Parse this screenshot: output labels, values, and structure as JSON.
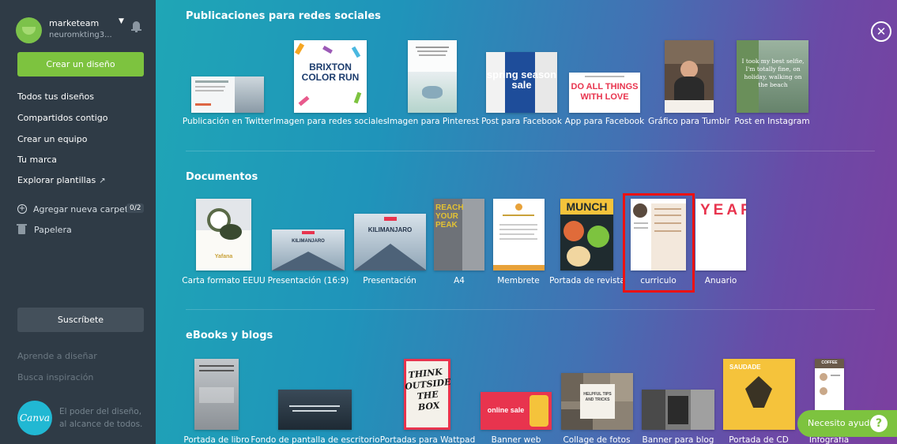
{
  "sidebar": {
    "team_name": "marketeam",
    "team_subtitle": "neuromkting3...",
    "create_label": "Crear un diseño",
    "nav": [
      "Todos tus diseños",
      "Compartidos contigo",
      "Crear un equipo",
      "Tu marca",
      "Explorar plantillas"
    ],
    "explore_arrow": "↗",
    "folder_label": "Agregar nueva carpeta",
    "folder_count": "0/2",
    "trash_label": "Papelera",
    "subscribe_label": "Suscríbete",
    "learn_label": "Aprende a diseñar",
    "inspire_label": "Busca inspiración",
    "logo_text": "Canva",
    "slogan_line1": "El poder del diseño,",
    "slogan_line2": "al alcance de todos."
  },
  "main": {
    "close_symbol": "✕",
    "social": {
      "title": "Publicaciones para redes sociales",
      "items": [
        "Publicación en Twitter",
        "Imagen para redes sociales",
        "Imagen para Pinterest",
        "Post para Facebook",
        "App para Facebook",
        "Gráfico para Tumblr",
        "Post en Instagram"
      ],
      "thumb_text": {
        "brixton": "BRIXTON COLOR RUN",
        "spring": "spring season sale",
        "doall": "DO ALL THINGS WITH LOVE",
        "insta": "I took my best selfie, I'm totally fine, on holiday, walking on the beach"
      }
    },
    "documents": {
      "title": "Documentos",
      "items": [
        "Carta formato EEUU",
        "Presentación (16:9)",
        "Presentación",
        "A4",
        "Membrete",
        "Portada de revista",
        "curriculo",
        "Anuario"
      ],
      "thumb_text": {
        "kilimanjaro": "KILIMANJARO",
        "reach": "REACH YOUR PEAK",
        "munch": "MUNCH",
        "yearbook": "YEARBOOK",
        "yafana": "Yafana"
      }
    },
    "ebooks": {
      "title": "eBooks y blogs",
      "items": [
        "Portada de libro",
        "Fondo de pantalla de escritorio",
        "Portadas para Wattpad",
        "Banner web",
        "Collage de fotos",
        "Banner para blog",
        "Portada de CD",
        "Infografía"
      ],
      "thumb_text": {
        "think": "THINK OUTSIDE THE BOX",
        "online": "online sale",
        "saudade": "SAUDADE",
        "helpful": "HELPFUL TIPS AND TRICKS",
        "coffee": "COFFEE"
      }
    }
  },
  "help": {
    "label": "Necesito ayuda",
    "icon": "?"
  }
}
